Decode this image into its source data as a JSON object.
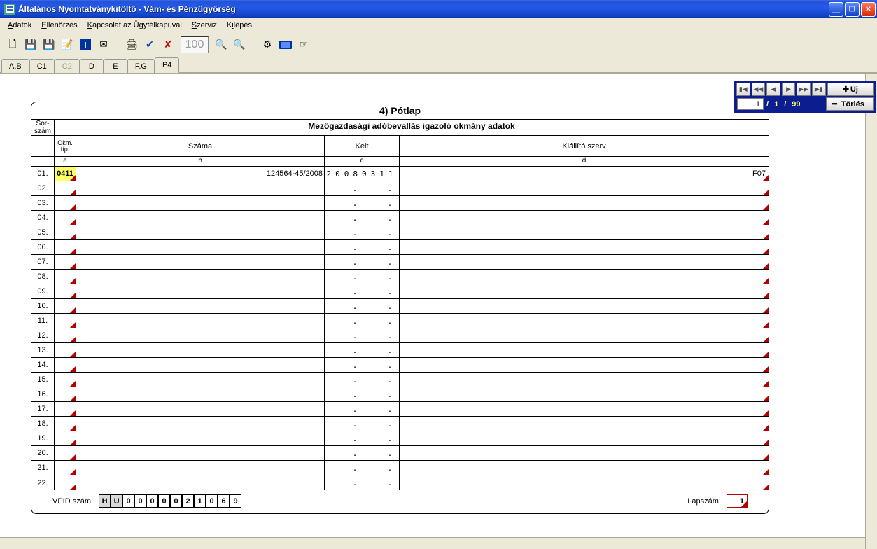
{
  "title": "Általános Nyomtatványkitöltő - Vám- és Pénzügyőrség",
  "menu": {
    "adatok": "Adatok",
    "ellenorzes": "Ellenőrzés",
    "kapcsolat": "Kapcsolat az Ügyfélkapuval",
    "szerviz": "Szerviz",
    "kilepes": "Kilépés"
  },
  "zoom": "100",
  "tabs": [
    "A.B",
    "C1",
    "C2",
    "D",
    "E",
    "F.G",
    "P4"
  ],
  "active_tab": "P4",
  "nav": {
    "page": "1",
    "cur": "1",
    "total": "99",
    "uj": "Új",
    "torles": "Törlés"
  },
  "form": {
    "title": "4) Pótlap",
    "subtitle": "Mezőgazdasági adóbevallás igazoló okmány adatok",
    "rowhdr": "Sor-\nszám",
    "cols": {
      "a": "Okm. típ.",
      "b": "Száma",
      "c": "Kelt",
      "d": "Kiállító szerv"
    },
    "letters": {
      "a": "a",
      "b": "b",
      "c": "c",
      "d": "d"
    },
    "rows": [
      {
        "n": "01.",
        "a": "0411",
        "b": "124564-45/2008",
        "c": "20080311",
        "d": "F07"
      },
      {
        "n": "02."
      },
      {
        "n": "03."
      },
      {
        "n": "04."
      },
      {
        "n": "05."
      },
      {
        "n": "06."
      },
      {
        "n": "07."
      },
      {
        "n": "08."
      },
      {
        "n": "09."
      },
      {
        "n": "10."
      },
      {
        "n": "11."
      },
      {
        "n": "12."
      },
      {
        "n": "13."
      },
      {
        "n": "14."
      },
      {
        "n": "15."
      },
      {
        "n": "16."
      },
      {
        "n": "17."
      },
      {
        "n": "18."
      },
      {
        "n": "19."
      },
      {
        "n": "20."
      },
      {
        "n": "21."
      },
      {
        "n": "22."
      }
    ],
    "vpid_label": "VPID szám:",
    "vpid": [
      "H",
      "U",
      "0",
      "0",
      "0",
      "0",
      "0",
      "2",
      "1",
      "0",
      "6",
      "9"
    ],
    "lapszam_label": "Lapszám:",
    "lapszam": "1"
  }
}
